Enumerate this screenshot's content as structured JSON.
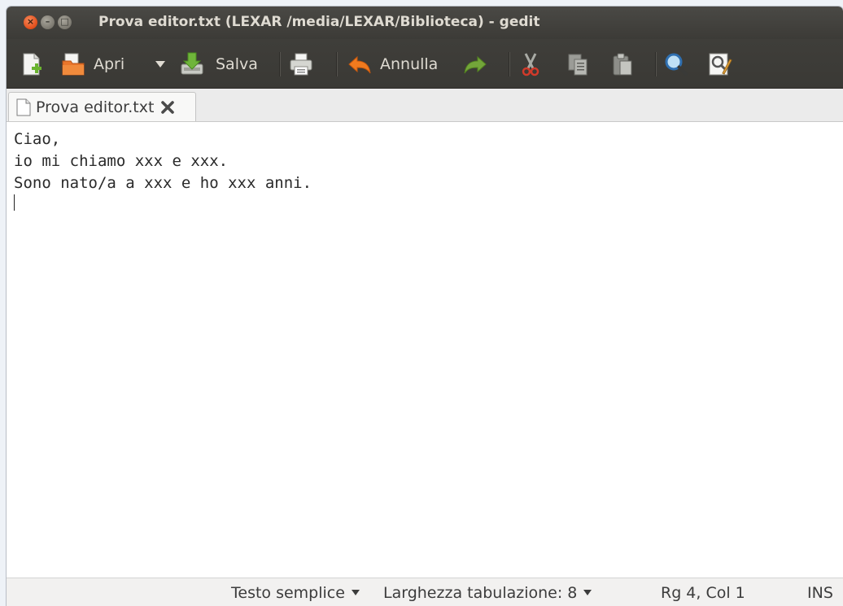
{
  "window": {
    "title": "Prova editor.txt (LEXAR /media/LEXAR/Biblioteca) - gedit"
  },
  "toolbar": {
    "new_icon": "new-document-icon",
    "open_label": "Apri",
    "save_label": "Salva",
    "print_icon": "print-icon",
    "undo_label": "Annulla",
    "redo_icon": "redo-icon",
    "cut_icon": "cut-icon",
    "copy_icon": "copy-icon",
    "paste_icon": "paste-icon",
    "search_icon": "search-icon",
    "replace_icon": "find-replace-icon"
  },
  "tabs": [
    {
      "label": "Prova editor.txt",
      "icon": "text-file-icon"
    }
  ],
  "editor": {
    "lines": [
      "Ciao,",
      "io mi chiamo xxx e xxx.",
      "Sono nato/a a xxx e ho xxx anni."
    ]
  },
  "statusbar": {
    "language": "Testo semplice",
    "tab_width": "Larghezza tabulazione: 8",
    "position": "Rg 4, Col 1",
    "mode": "INS"
  },
  "colors": {
    "titlebar": "#3c3b37",
    "close_button": "#e2501d",
    "undo_accent": "#f07a1e",
    "redo_accent": "#73a53a"
  }
}
